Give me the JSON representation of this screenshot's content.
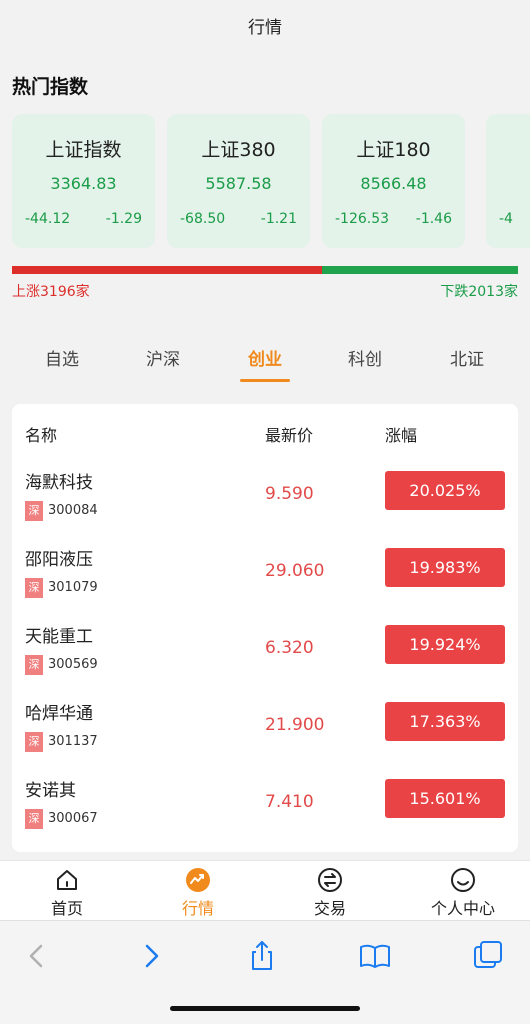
{
  "header": {
    "title": "行情"
  },
  "hot_indices": {
    "title": "热门指数",
    "cards": [
      {
        "name": "上证指数",
        "value": "3364.83",
        "change": "-44.12",
        "change_pct": "-1.29"
      },
      {
        "name": "上证380",
        "value": "5587.58",
        "change": "-68.50",
        "change_pct": "-1.21"
      },
      {
        "name": "上证180",
        "value": "8566.48",
        "change": "-126.53",
        "change_pct": "-1.46"
      },
      {
        "name": "",
        "value": "",
        "change": "-4",
        "change_pct": ""
      }
    ]
  },
  "market_breadth": {
    "up_label": "上涨3196家",
    "down_label": "下跌2013家",
    "up_count": 3196,
    "down_count": 2013,
    "up_color": "#dc2f2c",
    "down_color": "#21a24c"
  },
  "tabs": {
    "items": [
      "自选",
      "沪深",
      "创业",
      "科创",
      "北证"
    ],
    "active_index": 2,
    "active_color": "#f08a1c"
  },
  "stock_table": {
    "headers": {
      "name": "名称",
      "price": "最新价",
      "change": "涨幅"
    },
    "rows": [
      {
        "name": "海默科技",
        "market": "深",
        "code": "300084",
        "price": "9.590",
        "change": "20.025%"
      },
      {
        "name": "邵阳液压",
        "market": "深",
        "code": "301079",
        "price": "29.060",
        "change": "19.983%"
      },
      {
        "name": "天能重工",
        "market": "深",
        "code": "300569",
        "price": "6.320",
        "change": "19.924%"
      },
      {
        "name": "哈焊华通",
        "market": "深",
        "code": "301137",
        "price": "21.900",
        "change": "17.363%"
      },
      {
        "name": "安诺其",
        "market": "深",
        "code": "300067",
        "price": "7.410",
        "change": "15.601%"
      }
    ]
  },
  "bottom_nav": {
    "items": [
      {
        "label": "首页",
        "icon": "home-icon"
      },
      {
        "label": "行情",
        "icon": "market-trend-icon"
      },
      {
        "label": "交易",
        "icon": "exchange-icon"
      },
      {
        "label": "个人中心",
        "icon": "smiley-profile-icon"
      }
    ],
    "active_index": 1
  },
  "browser_toolbar": {
    "icons": [
      "back-chevron-icon",
      "forward-chevron-icon",
      "share-icon",
      "bookmarks-book-icon",
      "tabs-icon"
    ]
  }
}
